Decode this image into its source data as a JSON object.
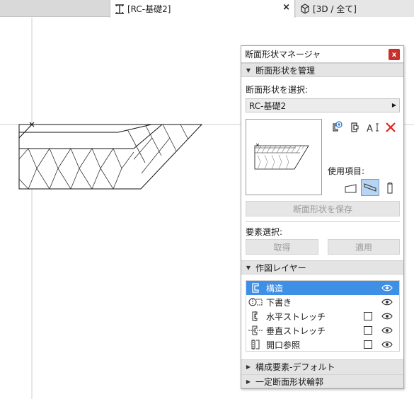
{
  "tabs": {
    "active": {
      "label": "[RC-基礎2]",
      "icon": "section-profile-icon",
      "close": "×"
    },
    "inactive": {
      "label": "[3D / 全て]",
      "icon": "3d-box-icon"
    }
  },
  "palette": {
    "title": "断面形状マネージャ",
    "close_label": "x",
    "manage_section": {
      "header": "断面形状を管理"
    },
    "select_label": "断面形状を選択:",
    "selected_profile": "RC-基礎2",
    "used_items_label": "使用項目:",
    "save_button": "断面形状を保存",
    "element_select_label": "要素選択:",
    "get_button": "取得",
    "apply_button": "適用",
    "layers_section": {
      "header": "作図レイヤー"
    },
    "layers": [
      {
        "name": "構造",
        "icon": "structure-layer-icon",
        "selected": true,
        "has_checkbox": false
      },
      {
        "name": "下書き",
        "icon": "draft-layer-icon",
        "selected": false,
        "has_checkbox": false
      },
      {
        "name": "水平ストレッチ",
        "icon": "horizontal-stretch-icon",
        "selected": false,
        "has_checkbox": true
      },
      {
        "name": "垂直ストレッチ",
        "icon": "vertical-stretch-icon",
        "selected": false,
        "has_checkbox": true
      },
      {
        "name": "開口参照",
        "icon": "opening-reference-icon",
        "selected": false,
        "has_checkbox": true
      }
    ],
    "components_section": {
      "header": "構成要素-デフォルト"
    },
    "fixed_section": {
      "header": "一定断面形状輪郭"
    }
  },
  "colors": {
    "selection": "#3e8fe6",
    "close_button": "#c9302c",
    "delete_icon": "#e2231a",
    "section_header": "#e4e4e4"
  }
}
